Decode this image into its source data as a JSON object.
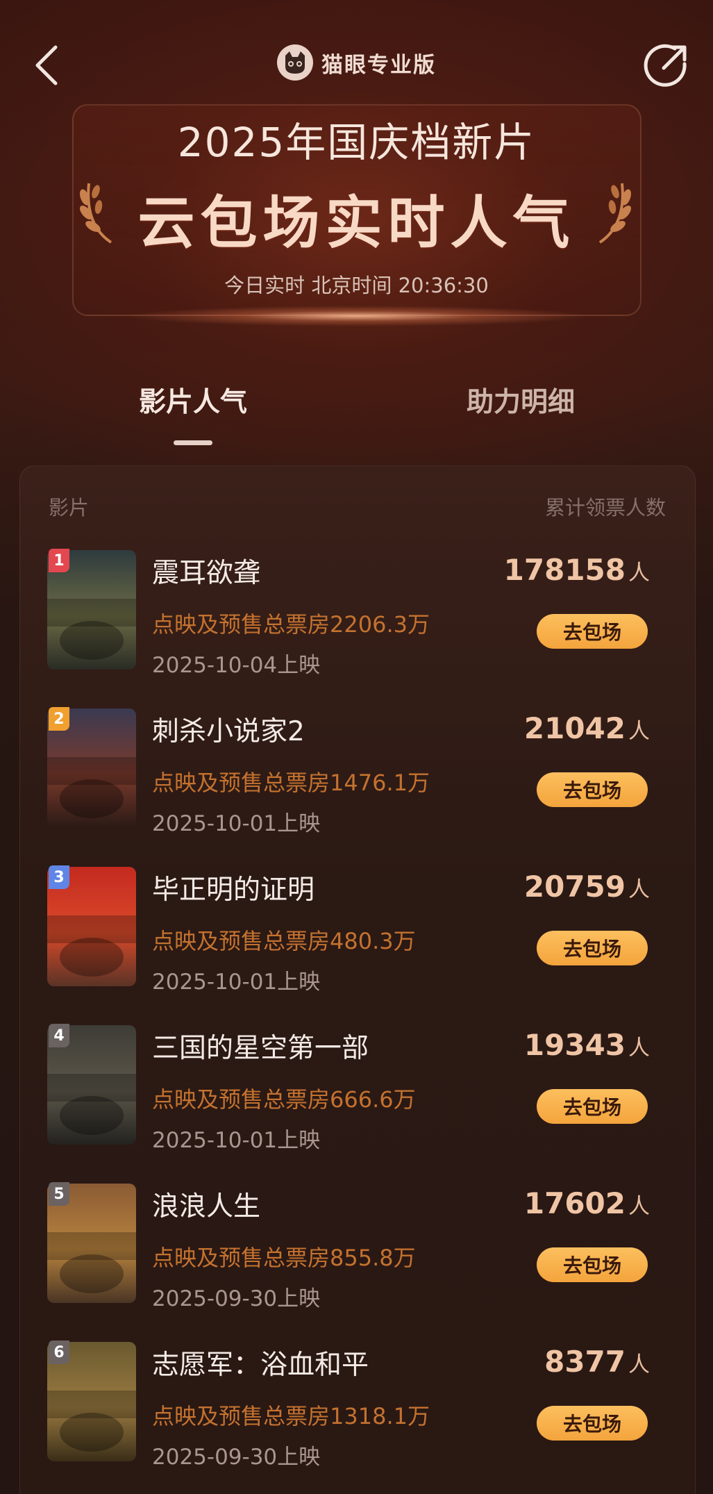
{
  "header": {
    "brand": "猫眼专业版",
    "title_line1": "2025年国庆档新片",
    "title_line2": "云包场实时人气",
    "time_label": "今日实时 北京时间 20:36:30"
  },
  "tabs": [
    {
      "label": "影片人气",
      "active": true
    },
    {
      "label": "助力明细",
      "active": false
    }
  ],
  "table": {
    "col_film": "影片",
    "col_count": "累计领票人数",
    "unit": "人",
    "action_label": "去包场"
  },
  "films": [
    {
      "rank": "1",
      "title": "震耳欲聋",
      "box_office": "点映及预售总票房2206.3万",
      "release": "2025-10-04上映",
      "count": "178158",
      "badge_color": "#e3474f",
      "poster_colors": [
        "#2e3b3e",
        "#6b6a45",
        "#2a2c25"
      ]
    },
    {
      "rank": "2",
      "title": "刺杀小说家2",
      "box_office": "点映及预售总票房1476.1万",
      "release": "2025-10-01上映",
      "count": "21042",
      "badge_color": "#f0a02f",
      "poster_colors": [
        "#3a3a52",
        "#7a3a2c",
        "#2a1a16"
      ]
    },
    {
      "rank": "3",
      "title": "毕正明的证明",
      "box_office": "点映及预售总票房480.3万",
      "release": "2025-10-01上映",
      "count": "20759",
      "badge_color": "#5f86e6",
      "poster_colors": [
        "#c42a20",
        "#d94a2a",
        "#5a3326"
      ]
    },
    {
      "rank": "4",
      "title": "三国的星空第一部",
      "box_office": "点映及预售总票房666.6万",
      "release": "2025-10-01上映",
      "count": "19343",
      "badge_color": "#6b6262",
      "poster_colors": [
        "#3e3c36",
        "#5c574a",
        "#23221f"
      ]
    },
    {
      "rank": "5",
      "title": "浪浪人生",
      "box_office": "点映及预售总票房855.8万",
      "release": "2025-09-30上映",
      "count": "17602",
      "badge_color": "#6b6262",
      "poster_colors": [
        "#8a5b34",
        "#b8833e",
        "#4a3524"
      ]
    },
    {
      "rank": "6",
      "title": "志愿军：浴血和平",
      "box_office": "点映及预售总票房1318.1万",
      "release": "2025-09-30上映",
      "count": "8377",
      "badge_color": "#6b6262",
      "poster_colors": [
        "#6a5a30",
        "#9a7a40",
        "#3a2e18"
      ]
    }
  ]
}
